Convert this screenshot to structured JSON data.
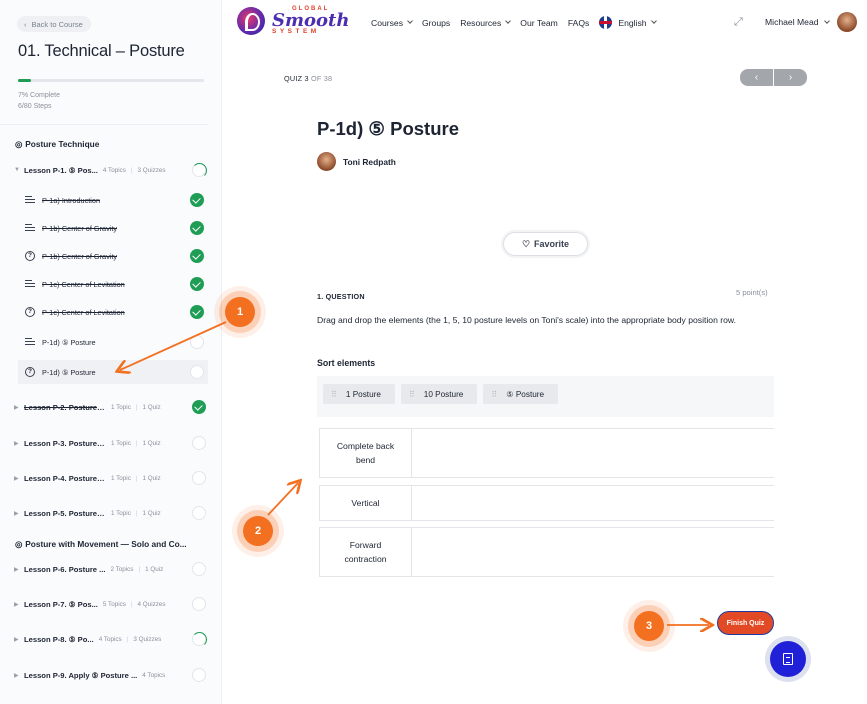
{
  "sidebar": {
    "back_label": "Back to Course",
    "course_title": "01. Technical – Posture",
    "progress_percent": 7,
    "progress_label": "7% Complete",
    "steps_label": "6/80 Steps",
    "sections": [
      {
        "title": "Posture Technique"
      },
      {
        "title": "Posture with Movement — Solo and Co..."
      }
    ],
    "lessons": [
      {
        "title": "Lesson P-1. ⑤ Pos...",
        "topics": "4 Topics",
        "quizzes": "3 Quizzes",
        "status": "partial",
        "done": false,
        "open": true
      },
      {
        "title": "Lesson P-2. Posture wi...",
        "topics": "1 Topic",
        "quizzes": "1 Quiz",
        "status": "done",
        "done": true
      },
      {
        "title": "Lesson P-3. Posture wi...",
        "topics": "1 Topic",
        "quizzes": "1 Quiz",
        "status": "empty",
        "done": false
      },
      {
        "title": "Lesson P-4. Posture wi...",
        "topics": "1 Topic",
        "quizzes": "1 Quiz",
        "status": "empty",
        "done": false
      },
      {
        "title": "Lesson P-5. Posture 1–...",
        "topics": "1 Topic",
        "quizzes": "1 Quiz",
        "status": "empty",
        "done": false
      },
      {
        "title": "Lesson P-6. Posture ...",
        "topics": "2 Topics",
        "quizzes": "1 Quiz",
        "status": "empty",
        "done": false
      },
      {
        "title": "Lesson P-7. ⑤ Pos...",
        "topics": "5 Topics",
        "quizzes": "4 Quizzes",
        "status": "empty",
        "done": false
      },
      {
        "title": "Lesson P-8. ⑤ Po...",
        "topics": "4 Topics",
        "quizzes": "3 Quizzes",
        "status": "partial",
        "done": false
      },
      {
        "title": "Lesson P-9. Apply ⑤ Posture ...",
        "topics": "4 Topics",
        "quizzes": "",
        "status": "empty",
        "done": false
      }
    ],
    "topics": [
      {
        "title": "P-1a) Introduction",
        "kind": "lesson",
        "status": "done",
        "done": true
      },
      {
        "title": "P-1b) Center of Gravity",
        "kind": "lesson",
        "status": "done",
        "done": true
      },
      {
        "title": "P-1b) Center of Gravity",
        "kind": "quiz",
        "status": "done",
        "done": true
      },
      {
        "title": "P-1c) Center of Levitation",
        "kind": "lesson",
        "status": "done",
        "done": true
      },
      {
        "title": "P-1c) Center of Levitation",
        "kind": "quiz",
        "status": "done",
        "done": true
      },
      {
        "title": "P-1d) ⑤ Posture",
        "kind": "lesson",
        "status": "empty",
        "done": false
      },
      {
        "title": "P-1d) ⑤ Posture",
        "kind": "quiz",
        "status": "empty",
        "done": false,
        "active": true
      }
    ]
  },
  "header": {
    "logo": {
      "global": "GLOBAL",
      "smooth": "Smooth",
      "system": "SYSTEM"
    },
    "nav": [
      "Courses",
      "Groups",
      "Resources",
      "Our Team",
      "FAQs"
    ],
    "language": "English",
    "user_name": "Michael Mead"
  },
  "main": {
    "quiz_label": "QUIZ 3",
    "quiz_of": "OF 38",
    "prev_icon": "‹",
    "next_icon": "›",
    "title": "P-1d) ⑤ Posture",
    "author": "Toni Redpath",
    "favorite_label": "Favorite",
    "question_label": "1. QUESTION",
    "points": "5 point(s)",
    "question_text": "Drag and drop the elements (the 1, 5, 10 posture levels on Toni's scale) into the appropriate body position row.",
    "sort_label": "Sort elements",
    "sort_items": [
      "1 Posture",
      "10 Posture",
      "⑤ Posture"
    ],
    "drop_rows": [
      "Complete back bend",
      "Vertical",
      "Forward contraction"
    ],
    "finish_label": "Finish Quiz"
  },
  "annotations": {
    "markers": [
      "1",
      "2",
      "3"
    ],
    "color": "#f37021"
  },
  "colors": {
    "accent_green": "#1f9d55",
    "finish_orange": "#e24a26",
    "fab_blue": "#2020d8"
  }
}
